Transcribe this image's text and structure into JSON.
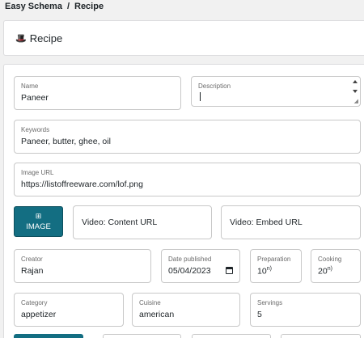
{
  "breadcrumb": {
    "root": "Easy Schema",
    "separator": "/",
    "current": "Recipe"
  },
  "header": {
    "title": "Recipe",
    "icon": "chef-hat-icon"
  },
  "form": {
    "name": {
      "label": "Name",
      "value": "Paneer"
    },
    "description": {
      "label": "Description",
      "value": ""
    },
    "keywords": {
      "label": "Keywords",
      "value": "Paneer, butter, ghee, oil"
    },
    "image_url": {
      "label": "Image URL",
      "value": "https://listoffreeware.com/lof.png"
    },
    "image_button": {
      "label": "IMAGE",
      "icon": "image-add-icon"
    },
    "video_content": {
      "placeholder": "Video: Content URL"
    },
    "video_embed": {
      "placeholder": "Video: Embed URL"
    },
    "creator": {
      "label": "Creator",
      "value": "Rajan"
    },
    "date_published": {
      "label": "Date published",
      "value": "05/04/2023"
    },
    "preparation": {
      "label": "Preparation",
      "value": "10",
      "suffix": "n)"
    },
    "cooking": {
      "label": "Cooking",
      "value": "20",
      "suffix": "n)"
    },
    "category": {
      "label": "Category",
      "value": "appetizer"
    },
    "cuisine": {
      "label": "Cuisine",
      "value": "american"
    },
    "servings": {
      "label": "Servings",
      "value": "5"
    }
  },
  "colors": {
    "accent": "#136e82",
    "border": "#c8c8c8",
    "background": "#f1f1f1"
  }
}
